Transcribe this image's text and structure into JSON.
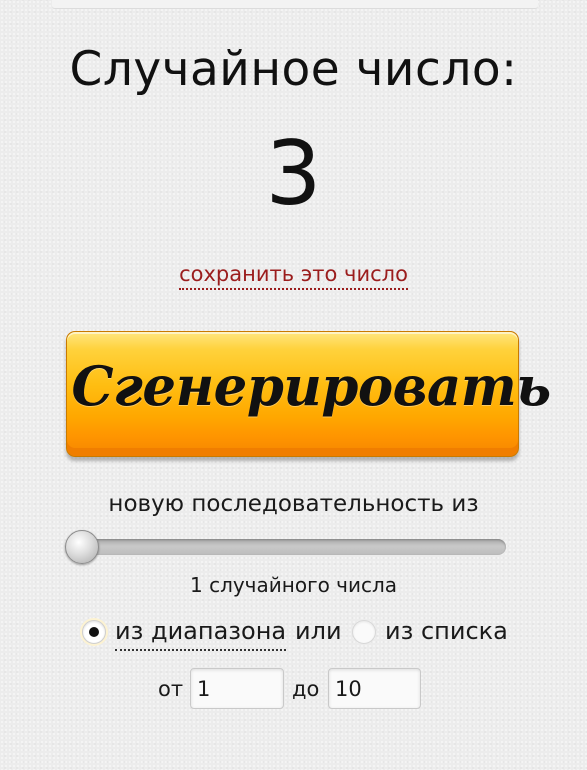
{
  "header": {
    "title": "Случайное число:",
    "number": "3",
    "save_link": "сохранить это число"
  },
  "generate_button": {
    "label": "Сгенерировать"
  },
  "sequence": {
    "text": "новую последовательность из",
    "slider_value": 1,
    "count_text": "1 случайного числа"
  },
  "source": {
    "range_option": "из диапазона",
    "or_text": "или",
    "list_option": "из списка",
    "selected": "range"
  },
  "range": {
    "from_label": "от",
    "from_value": "1",
    "to_label": "до",
    "to_value": "10"
  },
  "colors": {
    "link": "#9b1d1d",
    "button_top": "#ffd23c",
    "button_bottom": "#ff9500"
  }
}
